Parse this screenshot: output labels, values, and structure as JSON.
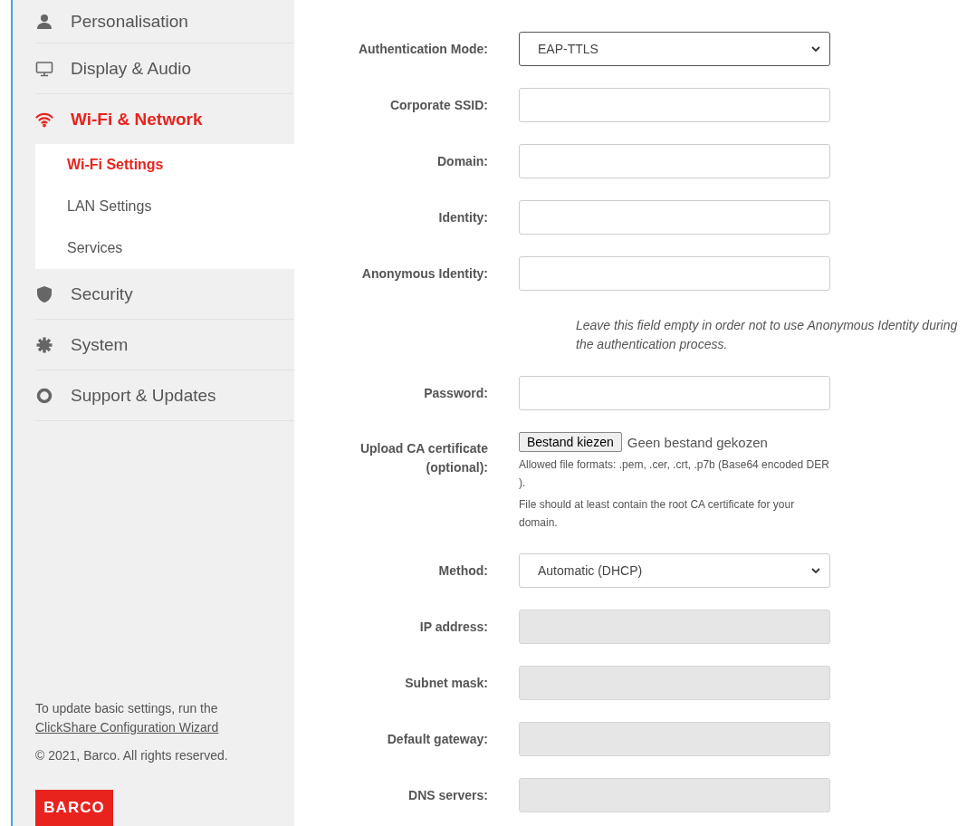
{
  "sidebar": {
    "items": [
      {
        "label": "Personalisation",
        "selected": false
      },
      {
        "label": "Display & Audio",
        "selected": false
      },
      {
        "label": "Wi-Fi & Network",
        "selected": true,
        "expanded": true,
        "children": [
          {
            "label": "Wi-Fi Settings",
            "selected": true
          },
          {
            "label": "LAN Settings",
            "selected": false
          },
          {
            "label": "Services",
            "selected": false
          }
        ]
      },
      {
        "label": "Security",
        "selected": false
      },
      {
        "label": "System",
        "selected": false
      },
      {
        "label": "Support & Updates",
        "selected": false
      }
    ],
    "footer": {
      "text": "To update basic settings, run the",
      "link": "ClickShare Configuration Wizard",
      "copyright": "© 2021, Barco. All rights reserved.",
      "logo": "BARCO"
    }
  },
  "form": {
    "rows": [
      {
        "kind": "select",
        "label": "Authentication Mode:",
        "value": "EAP-TTLS"
      },
      {
        "kind": "text",
        "label": "Corporate SSID:",
        "disabled": false
      },
      {
        "kind": "text",
        "label": "Domain:",
        "disabled": false
      },
      {
        "kind": "text",
        "label": "Identity:",
        "disabled": false
      },
      {
        "kind": "text",
        "label": "Anonymous Identity:",
        "disabled": false
      },
      {
        "kind": "note",
        "text": "Leave this field empty in order not to use Anonymous Identity during the authentication process."
      },
      {
        "kind": "text",
        "label": "Password:",
        "disabled": false
      },
      {
        "kind": "file",
        "label": "Upload CA certificate (optional):",
        "button": "Bestand kiezen",
        "status": "Geen bestand gekozen",
        "hints": [
          "Allowed file formats: .pem, .cer, .crt, .p7b (Base64 encoded DER ).",
          "File should at least contain the root CA certificate for your domain."
        ]
      },
      {
        "kind": "select",
        "label": "Method:",
        "value": "Automatic (DHCP)"
      },
      {
        "kind": "text",
        "label": "IP address:",
        "disabled": true
      },
      {
        "kind": "text",
        "label": "Subnet mask:",
        "disabled": true
      },
      {
        "kind": "text",
        "label": "Default gateway:",
        "disabled": true
      },
      {
        "kind": "text",
        "label": "DNS servers:",
        "disabled": true
      }
    ]
  }
}
